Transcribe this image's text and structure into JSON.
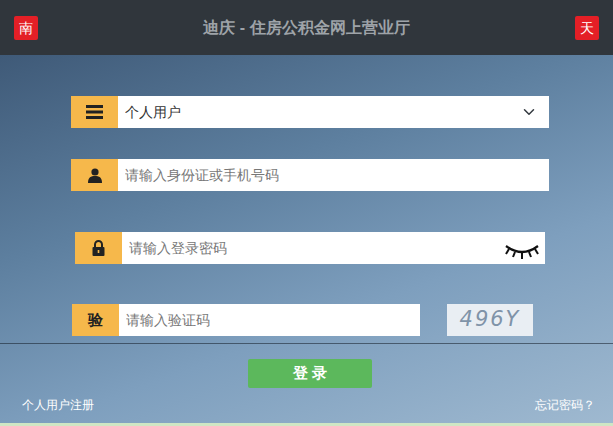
{
  "header": {
    "title": "迪庆 - 住房公积金网上营业厅",
    "left_badge": "南",
    "right_badge": "天"
  },
  "user_type": {
    "value": "个人用户"
  },
  "fields": [
    {
      "kind": "text",
      "placeholder": "请输入身份证或手机号码"
    },
    {
      "kind": "password",
      "placeholder": "请输入登录密码",
      "visible": false
    },
    {
      "kind": "captcha",
      "label": "验",
      "placeholder": "请输入验证码",
      "captcha": "496Y"
    }
  ],
  "login_button": "登 录",
  "links": [
    "个人用户注册",
    "忘记密码？"
  ]
}
